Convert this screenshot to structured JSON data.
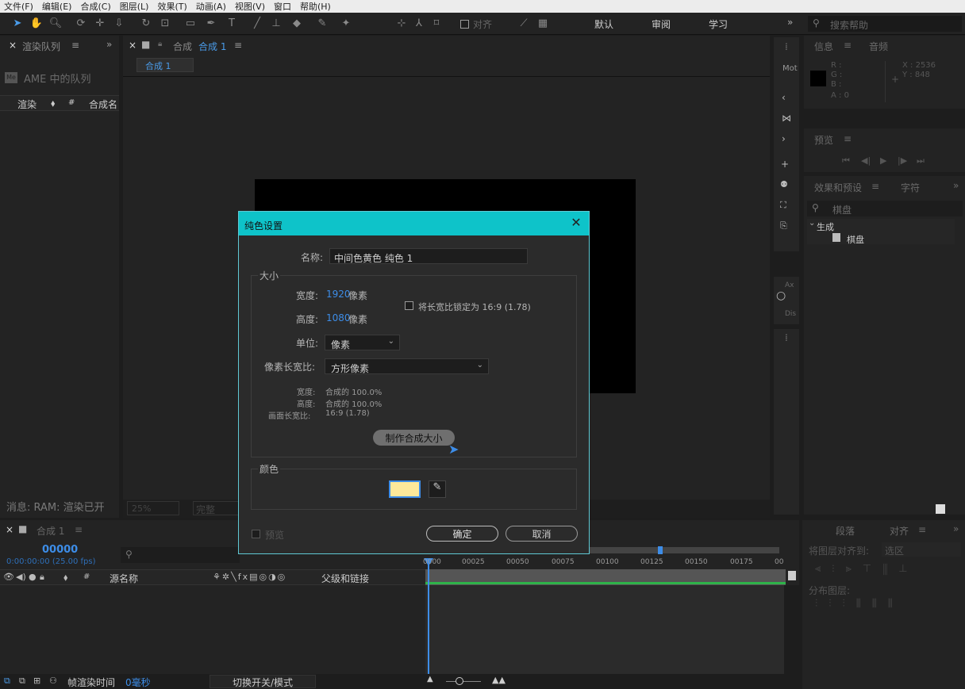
{
  "menu": [
    "文件(F)",
    "编辑(E)",
    "合成(C)",
    "图层(L)",
    "效果(T)",
    "动画(A)",
    "视图(V)",
    "窗口",
    "帮助(H)"
  ],
  "toolbar": {
    "snap_label": "对齐",
    "workspaces": [
      "默认",
      "审阅",
      "学习"
    ],
    "search_placeholder": "搜索帮助"
  },
  "render_queue": {
    "tab_label": "渲染队列",
    "ame_label": "AME 中的队列",
    "columns": [
      "渲染",
      "#",
      "合成名"
    ],
    "status": "消息: RAM: 渲染已开"
  },
  "composition": {
    "tab_prefix": "合成",
    "tab_name": "合成 1",
    "breadcrumb": "合成 1",
    "zoom": "25%",
    "resolution": "完整"
  },
  "info": {
    "tabs": [
      "信息",
      "音频"
    ],
    "r": "R :",
    "g": "G :",
    "b": "B :",
    "a": "A : 0",
    "x": "X : 2536",
    "y": "Y : 848"
  },
  "mini_panel": {
    "label1": "Mot",
    "label2": "Ax",
    "label3": "Dis"
  },
  "preview": {
    "tab_label": "预览"
  },
  "effects": {
    "tabs": [
      "效果和预设",
      "字符"
    ],
    "search_value": "棋盘",
    "category": "生成",
    "item": "棋盘"
  },
  "timeline": {
    "tab_name": "合成 1",
    "timecode": "00000",
    "timecode_sub": "0:00:00:00 (25.00 fps)",
    "columns": [
      "#",
      "源名称",
      "父级和链接"
    ],
    "ruler": [
      "0000",
      "00025",
      "00050",
      "00075",
      "00100",
      "00125",
      "00150",
      "00175",
      "00"
    ],
    "footer_label": "帧渲染时间",
    "footer_value": "0毫秒",
    "toggle_label": "切换开关/模式"
  },
  "align": {
    "tabs": [
      "段落",
      "对齐"
    ],
    "align_to_label": "将图层对齐到:",
    "align_to_value": "选区",
    "distribute_label": "分布图层:"
  },
  "dialog": {
    "title": "纯色设置",
    "name_label": "名称:",
    "name_value": "中间色黄色 纯色 1",
    "size_group": "大小",
    "width_label": "宽度:",
    "width_value": "1920",
    "height_label": "高度:",
    "height_value": "1080",
    "pixel_unit": "像素",
    "lock_label": "将长宽比锁定为 16:9 (1.78)",
    "unit_label": "单位:",
    "unit_value": "像素",
    "par_label": "像素长宽比:",
    "par_value": "方形像素",
    "info_width_label": "宽度:",
    "info_width_value": "合成的 100.0%",
    "info_height_label": "高度:",
    "info_height_value": "合成的 100.0%",
    "info_aspect_label": "画面长宽比:",
    "info_aspect_value": "16:9 (1.78)",
    "make_comp_size": "制作合成大小",
    "color_group": "颜色",
    "color_swatch": "#fde99a",
    "preview_label": "预览",
    "ok_label": "确定",
    "cancel_label": "取消"
  }
}
